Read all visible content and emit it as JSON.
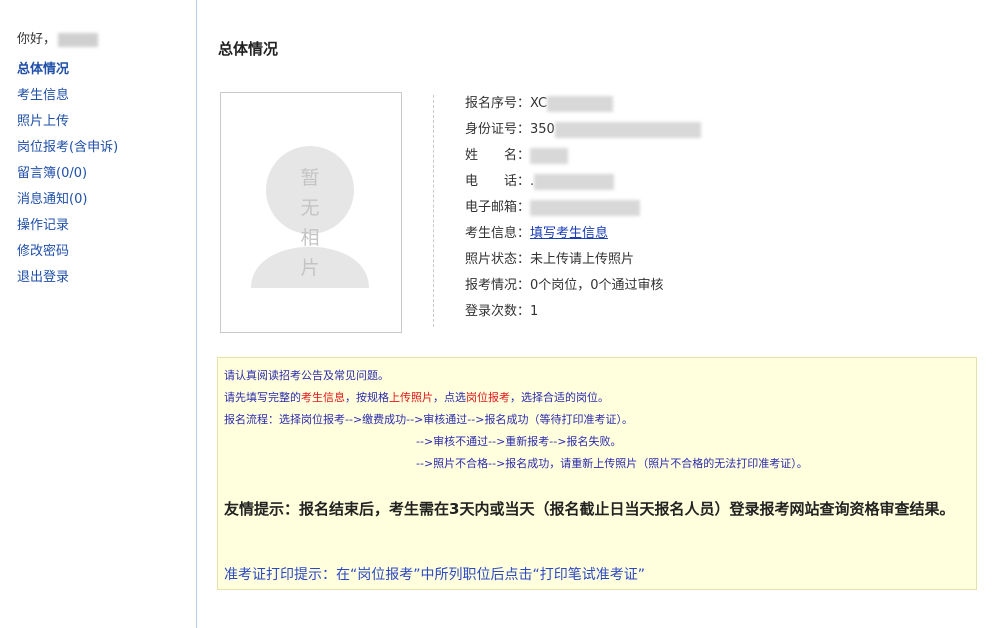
{
  "sidebar": {
    "greeting": "你好，",
    "items": [
      {
        "label": "总体情况"
      },
      {
        "label": "考生信息"
      },
      {
        "label": "照片上传"
      },
      {
        "label": "岗位报考(含申诉)"
      },
      {
        "label": "留言簿(0/0)"
      },
      {
        "label": "消息通知(0)"
      },
      {
        "label": "操作记录"
      },
      {
        "label": "修改密码"
      },
      {
        "label": "退出登录"
      }
    ]
  },
  "main": {
    "title": "总体情况",
    "photo_placeholder": [
      "暂",
      "无",
      "相",
      "片"
    ],
    "info": {
      "reg_no_label": "报名序号：",
      "reg_no_value": "XC",
      "id_label": "身份证号：",
      "id_value": "350",
      "name_label": "姓　　名：",
      "phone_label": "电　　话：",
      "phone_value": ".",
      "email_label": "电子邮箱：",
      "candidate_label": "考生信息：",
      "candidate_link": "填写考生信息",
      "photo_label": "照片状态：",
      "photo_value": "未上传请上传照片",
      "apply_label": "报考情况：",
      "apply_value": "0个岗位，0个通过审核",
      "login_label": "登录次数：",
      "login_value": "1"
    },
    "notice": {
      "line1": "请认真阅读招考公告及常见问题。",
      "line2_a": "请先填写完整的",
      "line2_b": "考生信息",
      "line2_c": "，按规格",
      "line2_d": "上传照片",
      "line2_e": "，点选",
      "line2_f": "岗位报考",
      "line2_g": "，选择合适的岗位。",
      "line3": "报名流程：选择岗位报考-->缴费成功-->审核通过-->报名成功（等待打印准考证）。",
      "line4": "-->审核不通过-->重新报考-->报名失败。",
      "line5": "-->照片不合格-->报名成功，请重新上传照片（照片不合格的无法打印准考证）。",
      "tip": "友情提示：报名结束后，考生需在3天内或当天（报名截止日当天报名人员）登录报考网站查询资格审查结果。",
      "print_tip": "准考证打印提示：在“岗位报考”中所列职位后点击“打印笔试准考证”"
    }
  }
}
